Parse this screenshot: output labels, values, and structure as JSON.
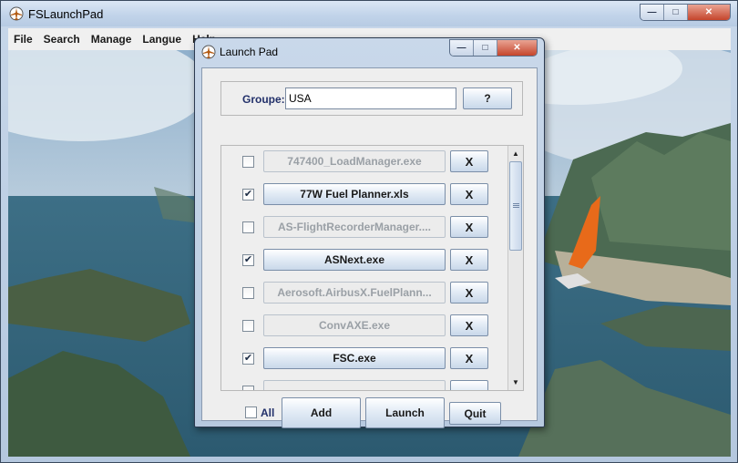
{
  "main_window": {
    "title": "FSLaunchPad",
    "menu": [
      "File",
      "Search",
      "Manage",
      "Langue",
      "Help"
    ]
  },
  "dialog": {
    "title": "Launch Pad",
    "groupe_label": "Groupe:",
    "groupe_value": "USA",
    "help_label": "?",
    "items": [
      {
        "label": "747400_LoadManager.exe",
        "checked": false,
        "check_mark": "",
        "remove_label": "X"
      },
      {
        "label": "77W Fuel Planner.xls",
        "checked": true,
        "check_mark": "✔",
        "remove_label": "X"
      },
      {
        "label": "AS-FlightRecorderManager....",
        "checked": false,
        "check_mark": "",
        "remove_label": "X"
      },
      {
        "label": "ASNext.exe",
        "checked": true,
        "check_mark": "✔",
        "remove_label": "X"
      },
      {
        "label": "Aerosoft.AirbusX.FuelPlann...",
        "checked": false,
        "check_mark": "",
        "remove_label": "X"
      },
      {
        "label": "ConvAXE.exe",
        "checked": false,
        "check_mark": "",
        "remove_label": "X"
      },
      {
        "label": "FSC.exe",
        "checked": true,
        "check_mark": "✔",
        "remove_label": "X"
      },
      {
        "label": "",
        "checked": false,
        "check_mark": "",
        "remove_label": ""
      }
    ],
    "all_label": "All",
    "add_label": "Add",
    "launch_label": "Launch",
    "quit_label": "Quit"
  },
  "window_controls": {
    "minimize": "—",
    "maximize": "□",
    "close": "✕"
  },
  "colors": {
    "accent": "#22306a",
    "titlebar": "#c2d4ea",
    "close": "#c5452c"
  },
  "icons": {
    "app": "airplane-app-icon",
    "check": "checkmark-icon",
    "scroll_up": "scroll-up-arrow-icon",
    "scroll_down": "scroll-down-arrow-icon"
  }
}
